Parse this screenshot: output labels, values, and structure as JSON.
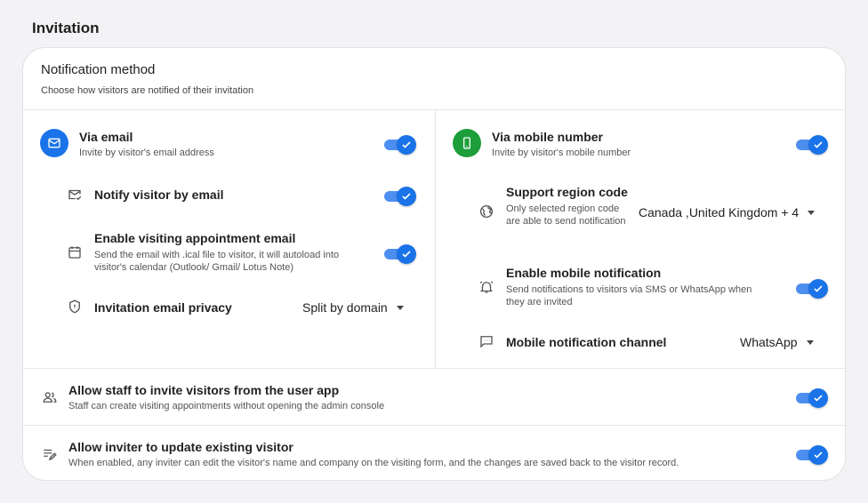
{
  "page": {
    "title": "Invitation"
  },
  "card": {
    "title": "Notification method",
    "subtitle": "Choose how visitors are notified of their invitation"
  },
  "email": {
    "title": "Via email",
    "desc": "Invite by visitor's email address",
    "enabled": true,
    "notify": {
      "label": "Notify visitor by email",
      "enabled": true
    },
    "appointment": {
      "label": "Enable visiting appointment email",
      "desc": "Send the email with .ical file to visitor, it will autoload into visitor's calendar (Outlook/ Gmail/ Lotus Note)",
      "enabled": true
    },
    "privacy": {
      "label": "Invitation email privacy",
      "value": "Split by domain"
    }
  },
  "mobile": {
    "title": "Via mobile number",
    "desc": "Invite by visitor's mobile number",
    "enabled": true,
    "region": {
      "label": "Support region code",
      "desc": "Only selected region code are able to send notification",
      "value": "Canada ,United Kingdom + 4"
    },
    "notification": {
      "label": "Enable mobile notification",
      "desc": "Send notifications to visitors via SMS or WhatsApp when they are invited",
      "enabled": true
    },
    "channel": {
      "label": "Mobile notification channel",
      "value": "WhatsApp"
    }
  },
  "staff": {
    "title": "Allow staff to invite visitors from the user app",
    "desc": "Staff can create visiting appointments without opening the admin console",
    "enabled": true
  },
  "inviter": {
    "title": "Allow inviter to update existing visitor",
    "desc": "When enabled, any inviter can edit the visitor's name and company on the visiting form, and the changes are saved back to the visitor record.",
    "enabled": true
  },
  "colors": {
    "accent": "#1a73e8",
    "email_circle": "#1a73e8",
    "mobile_circle": "#1e9e3a",
    "toggle_track": "#4d8ff0"
  },
  "icons": {
    "email": "mail-icon",
    "mobile": "phone-icon",
    "notify": "mail-check-icon",
    "appointment": "calendar-icon",
    "privacy": "shield-icon",
    "region": "globe-icon",
    "notification": "bell-icon",
    "channel": "chat-icon",
    "staff": "people-icon",
    "inviter": "edit-list-icon"
  }
}
